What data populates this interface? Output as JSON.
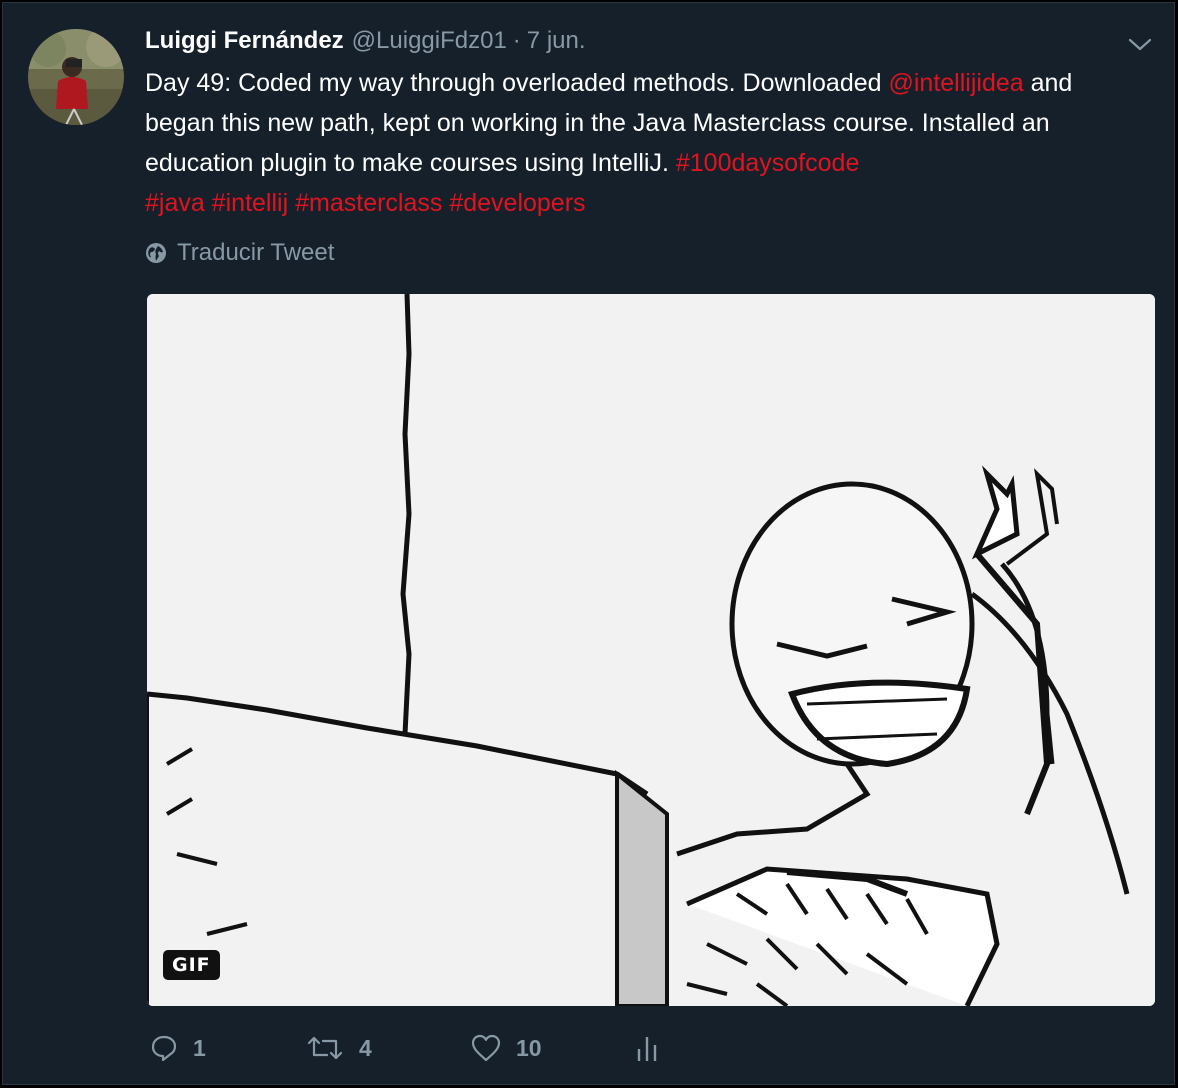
{
  "tweet": {
    "author_name": "Luiggi Fernández",
    "handle": "@LuiggiFdz01",
    "separator": "·",
    "time": "7 jun.",
    "text": {
      "part1": "Day 49: Coded my way through overloaded methods. Downloaded ",
      "mention": "@intellijidea",
      "part2": " and began this new path, kept on working in the Java Masterclass course. Installed an education plugin to make courses using IntelliJ. ",
      "hashtags": [
        "#100daysofcode",
        "#java",
        "#intellij",
        "#masterclass",
        "#developers"
      ]
    },
    "translate_label": "Traducir Tweet",
    "media": {
      "badge": "GIF"
    },
    "actions": {
      "replies": "1",
      "retweets": "4",
      "likes": "10"
    }
  },
  "icons": {
    "menu": "chevron-down-icon",
    "translate": "globe-icon",
    "reply": "reply-icon",
    "retweet": "retweet-icon",
    "like": "heart-icon",
    "analytics": "analytics-icon"
  },
  "colors": {
    "background": "#15202b",
    "link": "#e0141e",
    "secondary_text": "#8899a6",
    "primary_text": "#ffffff"
  }
}
